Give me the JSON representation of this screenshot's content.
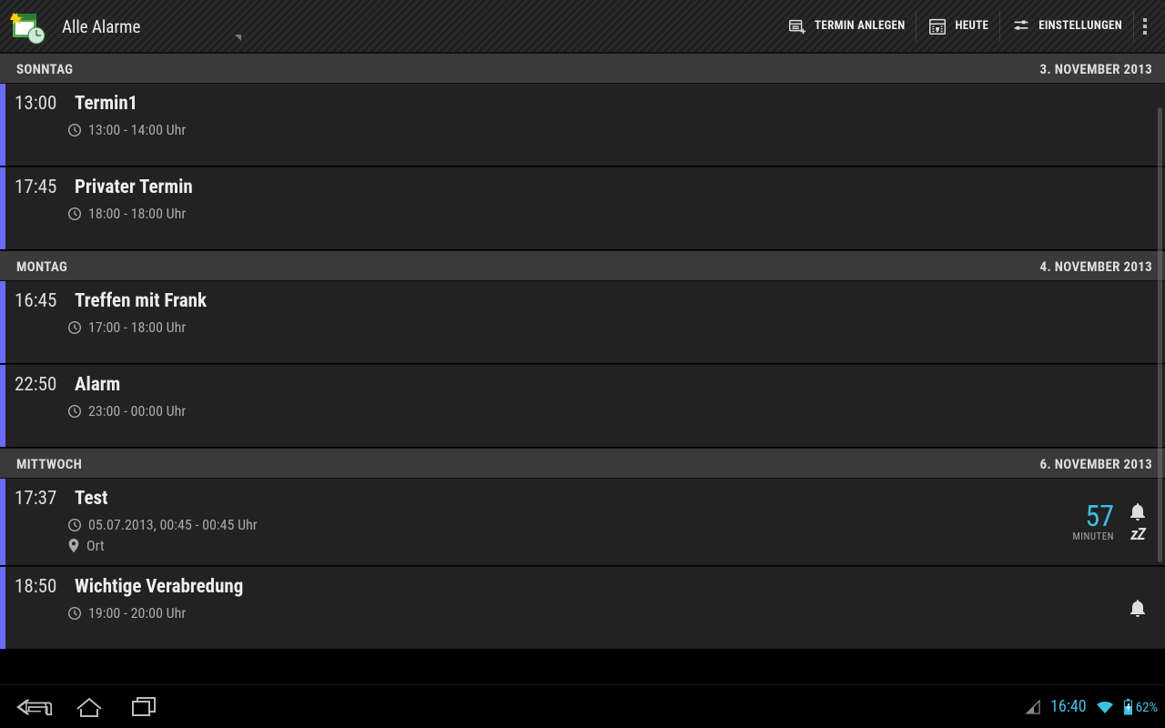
{
  "header": {
    "title": "Alle Alarme",
    "actions": {
      "create": "TERMIN ANLEGEN",
      "today": "HEUTE",
      "settings": "EINSTELLUNGEN"
    }
  },
  "sections": [
    {
      "day": "SONNTAG",
      "date": "3. NOVEMBER 2013",
      "events": [
        {
          "time": "13:00",
          "title": "Termin1",
          "timerange": "13:00 - 14:00 Uhr"
        },
        {
          "time": "17:45",
          "title": "Privater Termin",
          "timerange": "18:00 - 18:00 Uhr"
        }
      ]
    },
    {
      "day": "MONTAG",
      "date": "4. NOVEMBER 2013",
      "events": [
        {
          "time": "16:45",
          "title": "Treffen mit Frank",
          "timerange": "17:00 - 18:00 Uhr"
        },
        {
          "time": "22:50",
          "title": "Alarm",
          "timerange": "23:00 - 00:00 Uhr"
        }
      ]
    },
    {
      "day": "MITTWOCH",
      "date": "6. NOVEMBER 2013",
      "events": [
        {
          "time": "17:37",
          "title": "Test",
          "timerange": "05.07.2013, 00:45 - 00:45 Uhr",
          "location": "Ort",
          "countdown_value": "57",
          "countdown_label": "MINUTEN",
          "snooze": "zZ",
          "bell": true
        },
        {
          "time": "18:50",
          "title": "Wichtige Verabredung",
          "timerange": "19:00 - 20:00 Uhr",
          "bell": true
        }
      ]
    }
  ],
  "status": {
    "clock": "16:40",
    "battery": "62%"
  }
}
